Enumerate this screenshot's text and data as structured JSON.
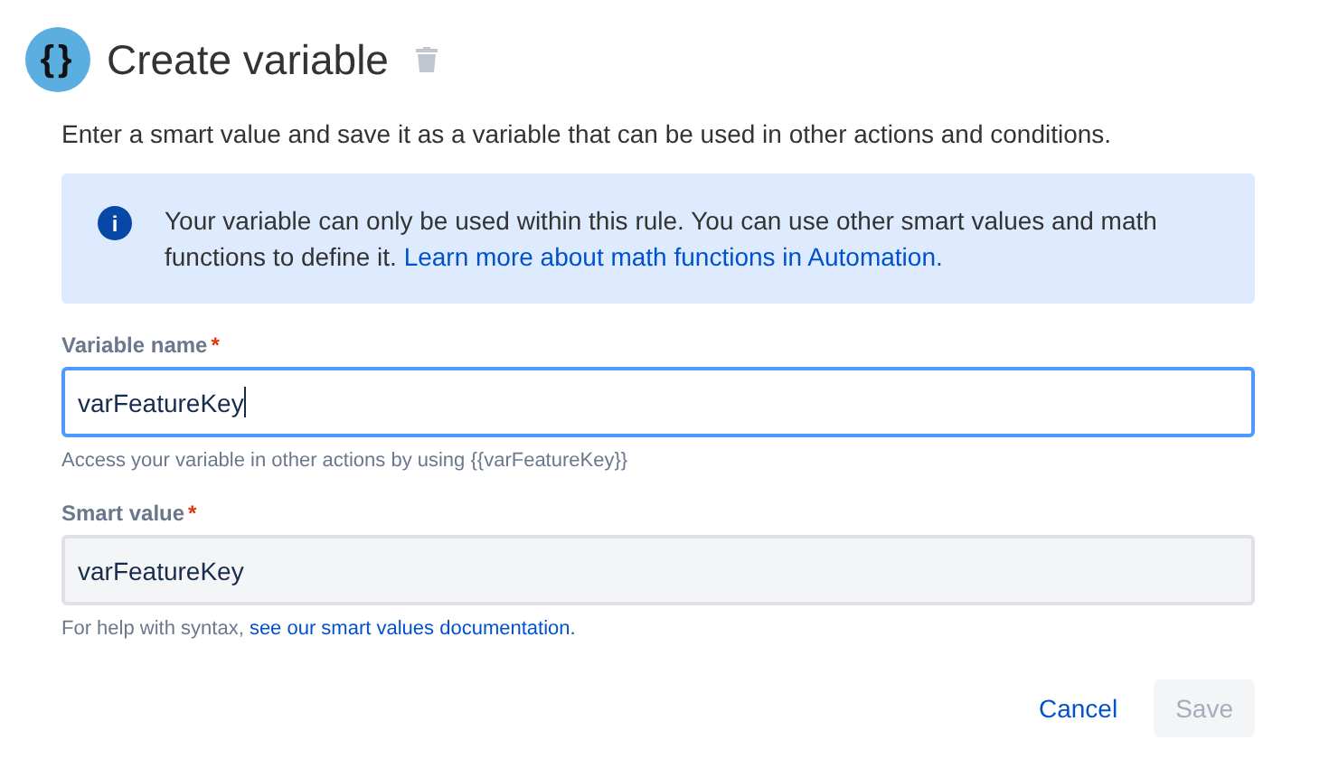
{
  "header": {
    "logo": "{}",
    "title": "Create variable"
  },
  "description": "Enter a smart value and save it as a variable that can be used in other actions and conditions.",
  "info_banner": {
    "icon": "i",
    "text": "Your variable can only be used within this rule. You can use other smart values and math functions to define it.",
    "link": "Learn more about math functions in Automation."
  },
  "fields": [
    {
      "label": "Variable name",
      "required_mark": "*",
      "value": "varFeatureKey",
      "focused": true,
      "help": "Access your variable in other actions by using {{varFeatureKey}}"
    },
    {
      "label": "Smart value",
      "required_mark": "*",
      "value": "varFeatureKey",
      "focused": false,
      "help": "For help with syntax,",
      "help_link": "see our smart values documentation."
    }
  ],
  "buttons": [
    {
      "label": "Cancel",
      "kind": "link",
      "disabled": false
    },
    {
      "label": "Save",
      "kind": "primary",
      "disabled": true
    }
  ]
}
